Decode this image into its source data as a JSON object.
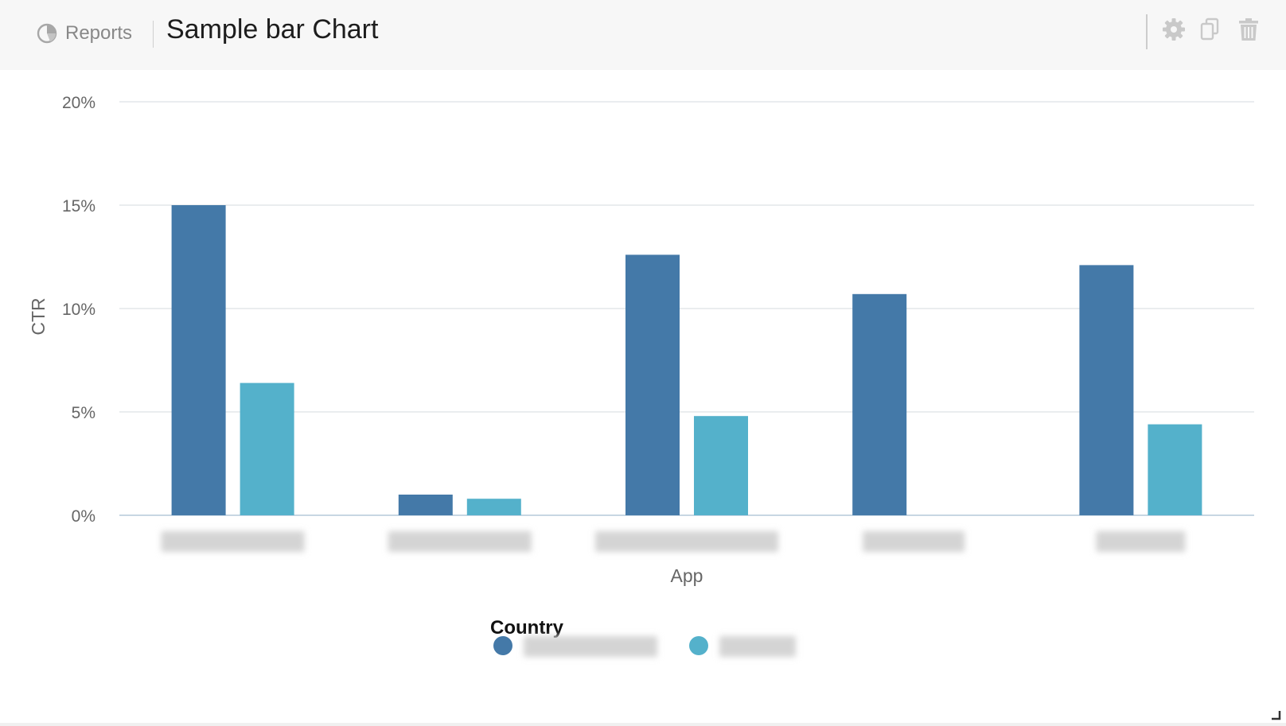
{
  "header": {
    "breadcrumb_label": "Reports",
    "breadcrumb_icon": "pie-chart-icon",
    "title": "Sample bar Chart",
    "tools": [
      {
        "name": "settings",
        "icon": "gear-icon"
      },
      {
        "name": "duplicate",
        "icon": "copy-icon"
      },
      {
        "name": "delete",
        "icon": "trash-icon"
      }
    ]
  },
  "chart_data": {
    "type": "bar",
    "title": "Sample bar Chart",
    "xlabel": "App",
    "ylabel": "CTR",
    "ylim": [
      0,
      20
    ],
    "y_ticks": [
      "0%",
      "5%",
      "10%",
      "15%",
      "20%"
    ],
    "y_tick_values": [
      0,
      5,
      10,
      15,
      20
    ],
    "grid": true,
    "categories": [
      "",
      "",
      "",
      "",
      ""
    ],
    "category_labels_obscured": true,
    "legend": {
      "title": "Country",
      "position": "bottom-center"
    },
    "series": [
      {
        "name": "",
        "color": "#4479a8",
        "values": [
          15.0,
          1.0,
          12.6,
          10.7,
          12.1
        ]
      },
      {
        "name": "",
        "color": "#54b1cb",
        "values": [
          6.4,
          0.8,
          4.8,
          0,
          4.4
        ]
      }
    ]
  },
  "colors": {
    "grid": "#e3e7ea",
    "axis": "#c7d6e3",
    "tick_text": "#666666",
    "blur_fill": "#d4d4d4"
  }
}
